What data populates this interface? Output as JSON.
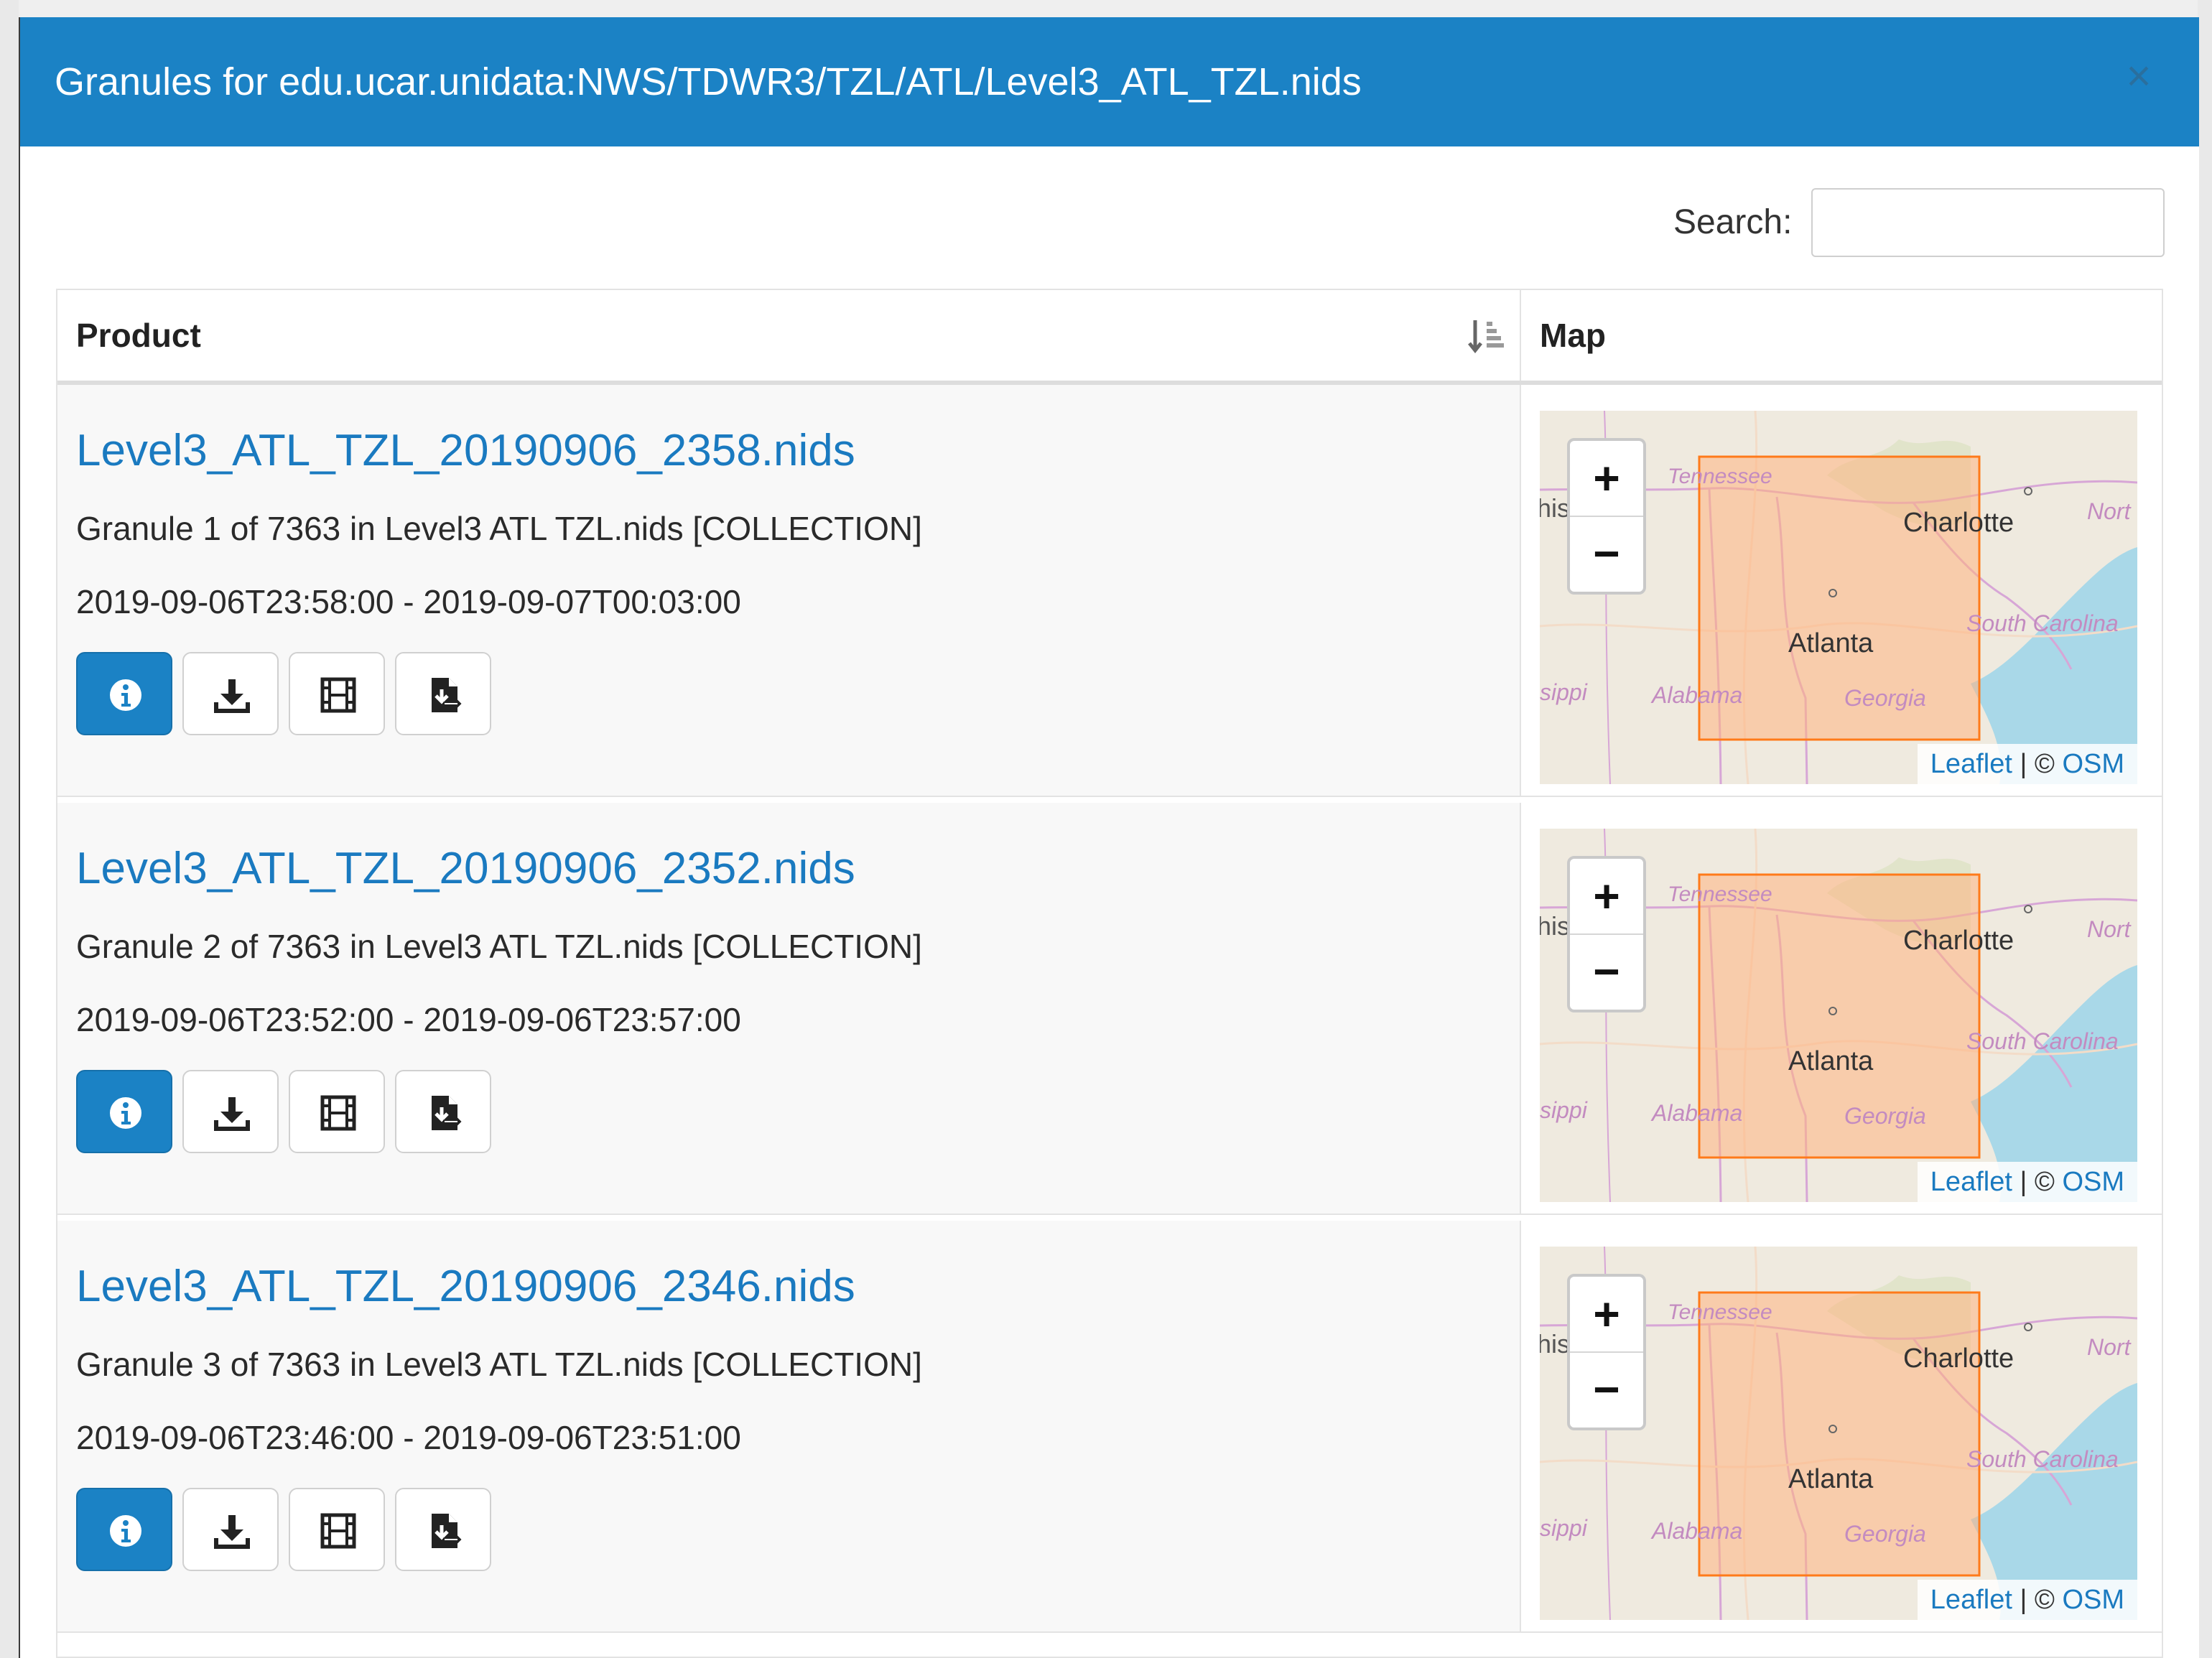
{
  "modal": {
    "title": "Granules for edu.ucar.unidata:NWS/TDWR3/TZL/ATL/Level3_ATL_TZL.nids",
    "close_glyph": "×"
  },
  "search": {
    "label": "Search:",
    "value": "",
    "placeholder": ""
  },
  "table": {
    "columns": [
      "Product",
      "Map"
    ],
    "sort_icon": "sort-descending-icon"
  },
  "rows": [
    {
      "name": "Level3_ATL_TZL_20190906_2358.nids",
      "description": "Granule 1 of 7363 in Level3 ATL TZL.nids [COLLECTION]",
      "time_range": "2019-09-06T23:58:00 - 2019-09-07T00:03:00"
    },
    {
      "name": "Level3_ATL_TZL_20190906_2352.nids",
      "description": "Granule 2 of 7363 in Level3 ATL TZL.nids [COLLECTION]",
      "time_range": "2019-09-06T23:52:00 - 2019-09-06T23:57:00"
    },
    {
      "name": "Level3_ATL_TZL_20190906_2346.nids",
      "description": "Granule 3 of 7363 in Level3 ATL TZL.nids [COLLECTION]",
      "time_range": "2019-09-06T23:46:00 - 2019-09-06T23:51:00"
    }
  ],
  "row_actions": [
    "info-icon",
    "download-icon",
    "film-icon",
    "file-import-icon"
  ],
  "map": {
    "labels": {
      "tennessee": "Tennessee",
      "charlotte": "Charlotte",
      "north": "Nort",
      "south_carolina": "South Carolina",
      "atlanta": "Atlanta",
      "georgia": "Georgia",
      "alabama": "Alabama",
      "mississippi": "sippi",
      "partial": "his"
    },
    "zoom_in": "+",
    "zoom_out": "−",
    "attribution": {
      "leaflet": "Leaflet",
      "separator": " | © ",
      "osm": "OSM"
    }
  },
  "colors": {
    "header": "#1b82c5",
    "link": "#1a7ac0",
    "bbox_fill": "#ffb380",
    "bbox_stroke": "#ff7a1a",
    "water": "#a9d8e8"
  }
}
